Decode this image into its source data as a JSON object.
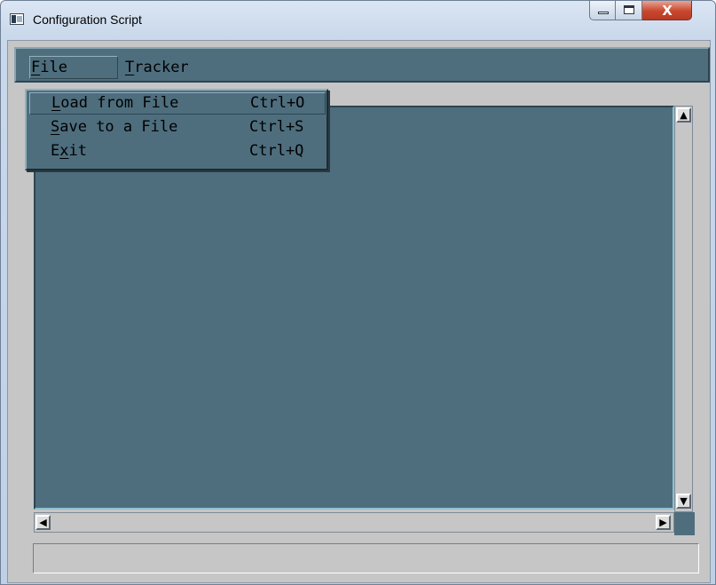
{
  "window": {
    "title": "Configuration Script",
    "close_glyph": "X"
  },
  "menubar": {
    "items": [
      {
        "pre": "",
        "mnemonic": "F",
        "post": "ile"
      },
      {
        "pre": "",
        "mnemonic": "T",
        "post": "racker"
      }
    ]
  },
  "file_menu": {
    "items": [
      {
        "pre": "",
        "mnemonic": "L",
        "post": "oad from File",
        "shortcut": "Ctrl+O"
      },
      {
        "pre": "",
        "mnemonic": "S",
        "post": "ave to a File",
        "shortcut": "Ctrl+S"
      },
      {
        "pre": "E",
        "mnemonic": "x",
        "post": "it",
        "shortcut": "Ctrl+Q"
      }
    ]
  },
  "scroll": {
    "up": "▲",
    "down": "▼",
    "left": "◀",
    "right": "▶"
  },
  "colors": {
    "panel": "#4e6e7e",
    "background": "#c6c6c6",
    "close_button": "#c8472e"
  }
}
